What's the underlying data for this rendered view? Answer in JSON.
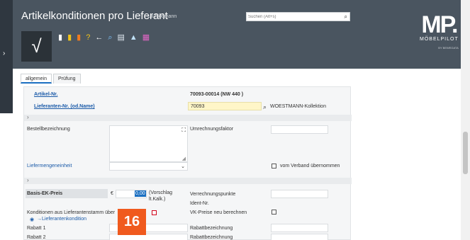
{
  "header": {
    "title": "Artikelkonditionen pro Lieferant",
    "user": "Uli Flottmann",
    "search_placeholder": "Suchen (Alt+s)"
  },
  "toolbar": {
    "icons": [
      "document-icon",
      "bookmark-icon",
      "delete-icon",
      "help-icon",
      "back-icon",
      "search-icon",
      "print-icon",
      "export-icon",
      "calendar-icon"
    ]
  },
  "logo": {
    "mark": "MP.",
    "name": "MÖBELPILOT",
    "sub": "BY BEWEGATA"
  },
  "tabs": [
    {
      "label": "allgemein",
      "active": true
    },
    {
      "label": "Prüfung",
      "active": false
    }
  ],
  "form": {
    "artikel_label": "Artikel-Nr.",
    "artikel_value": "70093-00014 (NW 440 )",
    "lieferant_label": "Lieferanten-Nr. (od.Name)",
    "lieferant_value": "70093",
    "lieferant_name": "WOESTMANN-Kollektion",
    "bestell_label": "Bestellbezeichnung",
    "umrechnung_label": "Umrechnungsfaktor",
    "liefermenge_label": "Liefermengeneinheit",
    "verband_label": "vom Verband übernommen",
    "basis_label": "Basis-EK-Preis",
    "currency": "€",
    "basis_value": "0,00",
    "vorschlag": "(Vorschlag lt.Kalk.)",
    "verrechnung_label": "Verrechnungspunkte",
    "ident_label": "Ident-Nr.",
    "konditionen_label": "Konditionen aus Lieferantenstamm über",
    "lieferantenkondition_link": "→Lieferantenkondition",
    "vk_label": "VK-Preise neu berechnen",
    "rabatt1_label": "Rabatt 1",
    "rabatt2_label": "Rabatt 2",
    "rabattbez1_label": "Rabattbezeichnung",
    "rabattbez2_label": "Rabattbezeichnung"
  },
  "badge": {
    "text": "16"
  },
  "colors": {
    "header": "#4a5560",
    "accent": "#1a6fc1",
    "badge": "#f05a1e",
    "highlight": "#fff6c8"
  }
}
